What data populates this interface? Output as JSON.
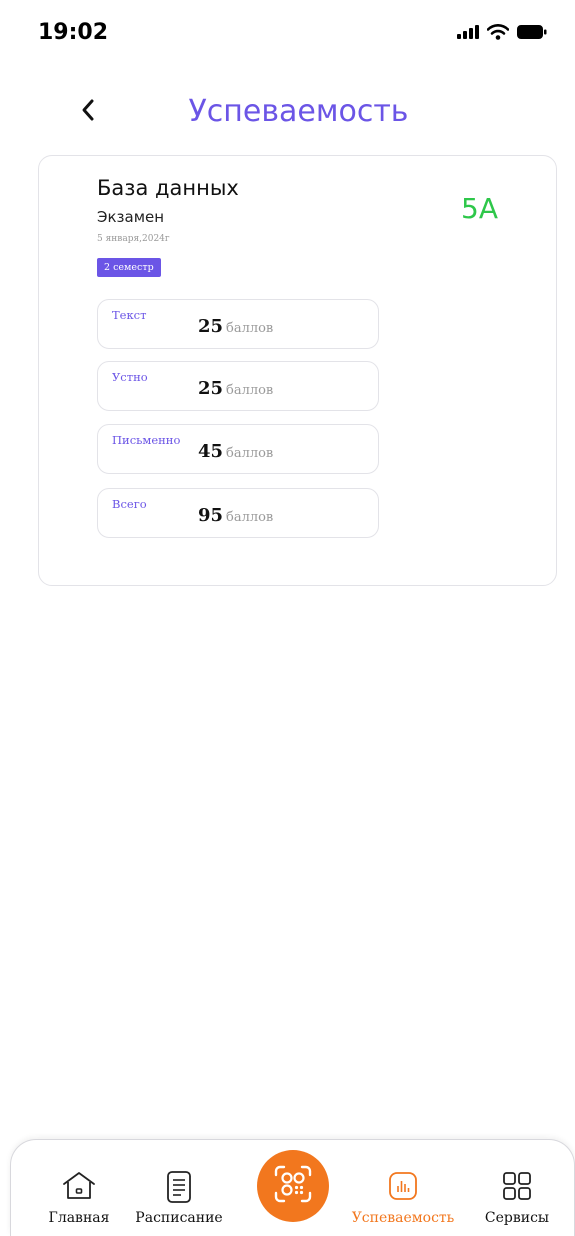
{
  "status_bar": {
    "time": "19:02",
    "icons": [
      "signal-icon",
      "wifi-icon",
      "battery-icon"
    ]
  },
  "header": {
    "back_icon": "chevron-left-icon",
    "title": "Успеваемость"
  },
  "card": {
    "subject": "База данных",
    "exam_type": "Экзамен",
    "date": "5 января,2024г",
    "semester": "2 семестр",
    "grade": "5A",
    "scores": [
      {
        "label": "Текст",
        "value": "25",
        "unit": "баллов"
      },
      {
        "label": "Устно",
        "value": "25",
        "unit": "баллов"
      },
      {
        "label": "Письменно",
        "value": "45",
        "unit": "баллов"
      },
      {
        "label": "Всего",
        "value": "95",
        "unit": "баллов"
      }
    ]
  },
  "bottom_nav": {
    "items": [
      {
        "label": "Главная",
        "icon": "home-icon"
      },
      {
        "label": "Расписание",
        "icon": "schedule-icon"
      },
      {
        "label": "Успеваемость",
        "icon": "chart-icon",
        "active": true
      },
      {
        "label": "Сервисы",
        "icon": "grid-icon"
      }
    ],
    "center_icon": "scan-icon"
  },
  "colors": {
    "accent": "#6b55e6",
    "grade": "#2ec74a",
    "nav_active": "#f2771e",
    "muted": "#9a9a9a"
  }
}
